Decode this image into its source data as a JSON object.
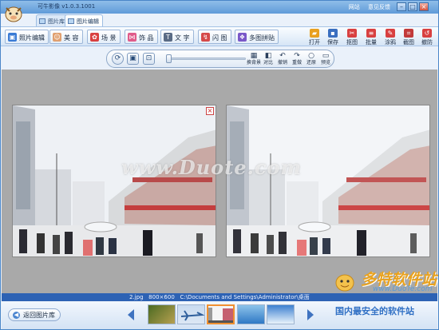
{
  "app": {
    "title": "可牛影像 v1.0.3.1001",
    "links": [
      "网站",
      "意见反馈"
    ]
  },
  "tabs": [
    {
      "label": "图片库",
      "active": false
    },
    {
      "label": "图片编辑",
      "active": true
    }
  ],
  "toolbar": {
    "left": [
      {
        "label": "照片编辑",
        "icon": "photo-edit-icon",
        "color": "#3a7bd5"
      },
      {
        "label": "美 容",
        "icon": "face-icon",
        "color": "#e0a070"
      },
      {
        "label": "场 景",
        "icon": "scene-icon",
        "color": "#d94040"
      },
      {
        "label": "饰 品",
        "icon": "bow-icon",
        "color": "#e05c8a"
      },
      {
        "label": "文 字",
        "icon": "text-icon",
        "color": "#5a6b85"
      },
      {
        "label": "闪 图",
        "icon": "flash-icon",
        "color": "#d64a4a"
      },
      {
        "label": "多图拼贴",
        "icon": "collage-icon",
        "color": "#7a58c8"
      }
    ],
    "right": [
      {
        "label": "打开",
        "icon": "open-icon",
        "color": "#e8a020"
      },
      {
        "label": "保存",
        "icon": "save-icon",
        "color": "#3a6fc0"
      },
      {
        "label": "抠图",
        "icon": "cutout-icon",
        "color": "#d84040"
      },
      {
        "label": "批量",
        "icon": "batch-icon",
        "color": "#d84040"
      },
      {
        "label": "涂鸦",
        "icon": "doodle-icon",
        "color": "#d84040"
      },
      {
        "label": "截图",
        "icon": "screenshot-icon",
        "color": "#c23a3a"
      },
      {
        "label": "撤防",
        "icon": "undo-all-icon",
        "color": "#d84040"
      }
    ]
  },
  "edit_bar": {
    "slider_value": 0,
    "tools": [
      {
        "label": "换背景",
        "glyph": "▦"
      },
      {
        "label": "对比",
        "glyph": "◧"
      },
      {
        "label": "撤销",
        "glyph": "↶"
      },
      {
        "label": "重做",
        "glyph": "↷"
      },
      {
        "label": "还原",
        "glyph": "○"
      },
      {
        "label": "预览",
        "glyph": "▭"
      }
    ]
  },
  "canvas": {
    "watermark": "www.Duote.com",
    "brand_name": "多特软件站",
    "brand_site": "www.DuoTe.com"
  },
  "status": {
    "text": "2.jpg   800×600   C:\\Documents and Settings\\Administrator\\桌面"
  },
  "bottom": {
    "back_label": "返回图片库",
    "slogan": "国内最安全的软件站",
    "thumbnails": [
      {
        "name": "thumb-green-field",
        "selected": false,
        "colors": [
          "#4b6a22",
          "#b7a050"
        ]
      },
      {
        "name": "thumb-airplane",
        "selected": false,
        "colors": [
          "#c9dbf0",
          "#2f5f9c"
        ]
      },
      {
        "name": "thumb-street",
        "selected": true,
        "colors": [
          "#f4f4f4",
          "#c56070"
        ]
      },
      {
        "name": "thumb-blue-wave",
        "selected": false,
        "colors": [
          "#8cc3ea",
          "#2f78c5"
        ]
      },
      {
        "name": "thumb-blue-banner",
        "selected": false,
        "colors": [
          "#3d80d0",
          "#e8f2fb"
        ]
      }
    ]
  }
}
